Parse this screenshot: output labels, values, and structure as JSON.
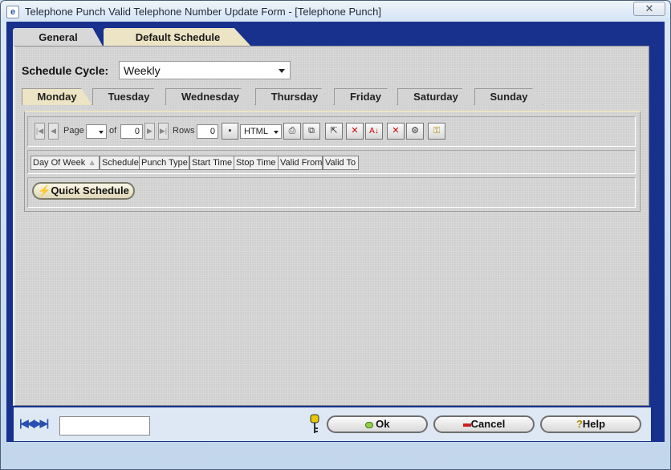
{
  "window": {
    "title": "Telephone Punch Valid Telephone Number Update Form - [Telephone Punch]",
    "close_label": "✕"
  },
  "outer_tabs": [
    {
      "label": "General",
      "active": false
    },
    {
      "label": "Default Schedule",
      "active": true
    }
  ],
  "schedule_cycle": {
    "label": "Schedule Cycle:",
    "value": "Weekly"
  },
  "day_tabs": [
    {
      "label": "Monday",
      "active": true
    },
    {
      "label": "Tuesday"
    },
    {
      "label": "Wednesday"
    },
    {
      "label": "Thursday"
    },
    {
      "label": "Friday"
    },
    {
      "label": "Saturday"
    },
    {
      "label": "Sunday"
    }
  ],
  "toolbar": {
    "page_label": "Page",
    "page_value": "",
    "of_label": "of",
    "of_value": "0",
    "rows_label": "Rows",
    "rows_value": "0",
    "format_value": "HTML"
  },
  "columns": [
    "Day Of Week",
    "Schedule",
    "Punch Type",
    "Start Time",
    "Stop Time",
    "Valid From",
    "Valid To"
  ],
  "quick_schedule": {
    "label": "Quick Schedule"
  },
  "footer": {
    "ok_label": "Ok",
    "cancel_label": "Cancel",
    "help_label": "Help",
    "record_value": ""
  },
  "colors": {
    "frame": "#17318d",
    "active_tab": "#ece4c4",
    "panel": "#d0d0d0"
  }
}
